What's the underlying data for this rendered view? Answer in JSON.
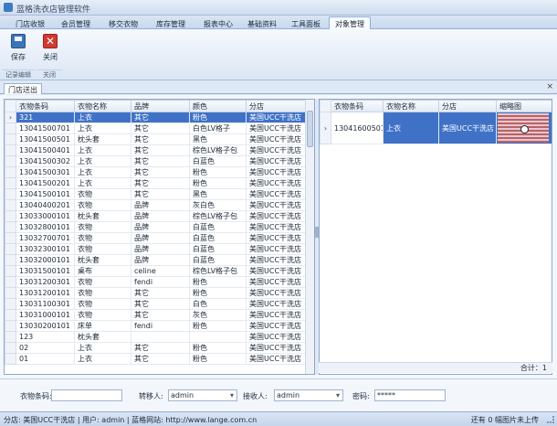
{
  "app": {
    "title": "蓝格洗衣店管理软件"
  },
  "menu": {
    "tabs": [
      "门店收银",
      "会员管理",
      "移交衣物",
      "库存管理",
      "报表中心",
      "基础资料",
      "工具面板",
      "对象管理"
    ],
    "active_index": 7
  },
  "ribbon": {
    "save_label": "保存",
    "close_label": "关闭",
    "group_edit": "记录编辑",
    "group_close": "关闭"
  },
  "document": {
    "tab_label": "门店送出",
    "close_glyph": "×"
  },
  "left_grid": {
    "columns": [
      "衣物条码",
      "衣物名称",
      "品牌",
      "颜色",
      "分店"
    ],
    "selected_row": 0,
    "rows": [
      [
        "321",
        "上衣",
        "其它",
        "粉色",
        "美国UCC干洗店"
      ],
      [
        "13041500701",
        "上衣",
        "其它",
        "白色LV格子",
        "美国UCC干洗店"
      ],
      [
        "13041500501",
        "枕头套",
        "其它",
        "黑色",
        "美国UCC干洗店"
      ],
      [
        "13041500401",
        "上衣",
        "其它",
        "棕色LV格子包",
        "美国UCC干洗店"
      ],
      [
        "13041500302",
        "上衣",
        "其它",
        "白蓝色",
        "美国UCC干洗店"
      ],
      [
        "13041500301",
        "上衣",
        "其它",
        "粉色",
        "美国UCC干洗店"
      ],
      [
        "13041500201",
        "上衣",
        "其它",
        "粉色",
        "美国UCC干洗店"
      ],
      [
        "13041500101",
        "衣物",
        "其它",
        "黑色",
        "美国UCC干洗店"
      ],
      [
        "13040400201",
        "衣物",
        "品牌",
        "灰白色",
        "美国UCC干洗店"
      ],
      [
        "13033000101",
        "枕头套",
        "品牌",
        "棕色LV格子包",
        "美国UCC干洗店"
      ],
      [
        "13032800101",
        "衣物",
        "品牌",
        "白蓝色",
        "美国UCC干洗店"
      ],
      [
        "13032700701",
        "衣物",
        "品牌",
        "白蓝色",
        "美国UCC干洗店"
      ],
      [
        "13032300101",
        "衣物",
        "品牌",
        "白蓝色",
        "美国UCC干洗店"
      ],
      [
        "13032000101",
        "枕头套",
        "品牌",
        "白蓝色",
        "美国UCC干洗店"
      ],
      [
        "13031500101",
        "桌布",
        "celine",
        "棕色LV格子包",
        "美国UCC干洗店"
      ],
      [
        "13031200301",
        "衣物",
        "fendi",
        "粉色",
        "美国UCC干洗店"
      ],
      [
        "13031200101",
        "衣物",
        "其它",
        "粉色",
        "美国UCC干洗店"
      ],
      [
        "13031100301",
        "衣物",
        "其它",
        "白色",
        "美国UCC干洗店"
      ],
      [
        "13031000101",
        "衣物",
        "其它",
        "灰色",
        "美国UCC干洗店"
      ],
      [
        "13030200101",
        "床单",
        "fendi",
        "粉色",
        "美国UCC干洗店"
      ],
      [
        "123",
        "枕头套",
        "",
        "",
        "美国UCC干洗店"
      ],
      [
        "02",
        "上衣",
        "其它",
        "粉色",
        "美国UCC干洗店"
      ],
      [
        "01",
        "上衣",
        "其它",
        "粉色",
        "美国UCC干洗店"
      ]
    ]
  },
  "right_grid": {
    "columns": [
      "衣物条码",
      "衣物名称",
      "分店",
      "缩略图"
    ],
    "rows": [
      [
        "13041600501",
        "上衣",
        "美国UCC干洗店",
        "thumbnail-image"
      ]
    ],
    "summary": "合计：1"
  },
  "form": {
    "barcode_label": "衣物条码:",
    "barcode_value": "",
    "transferor_label": "转移人:",
    "transferor_value": "admin",
    "receiver_label": "接收人:",
    "receiver_value": "admin",
    "password_label": "密码:",
    "password_value": "*****"
  },
  "status": {
    "branch": "分店: 美国UCC干洗店",
    "user": "用户: admin",
    "website": "蓝格网站: http://www.lange.com.cn",
    "right": "还有 0 幅图片未上传"
  },
  "colors": {
    "selection": "#3f72c7",
    "accent": "#8fb0d8"
  }
}
